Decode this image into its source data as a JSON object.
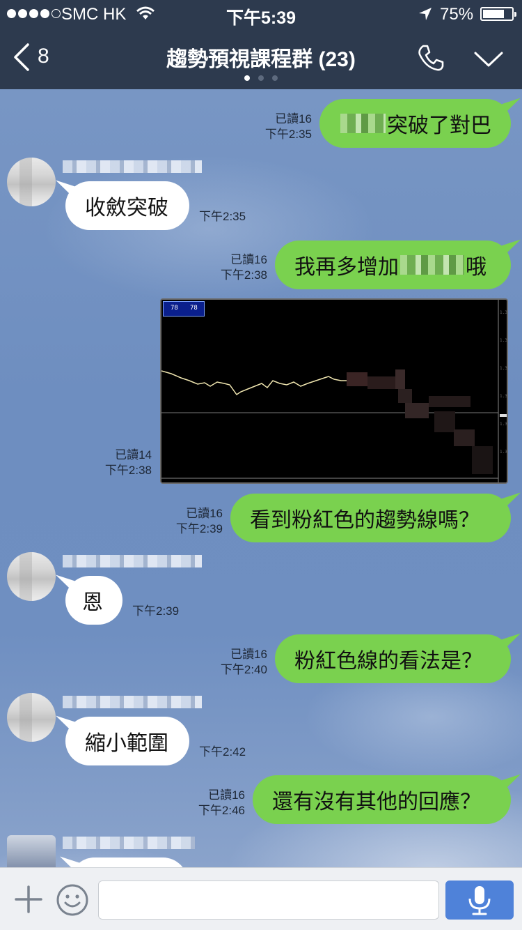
{
  "status_bar": {
    "carrier": "SMC HK",
    "time": "下午5:39",
    "battery": "75%",
    "battery_level": 0.75
  },
  "nav": {
    "back_count": "8",
    "title": "趨勢預視課程群 (23)",
    "page_count": 3,
    "active_page": 1
  },
  "messages": [
    {
      "id": "m1",
      "side": "out",
      "read": "已讀16",
      "time": "下午2:35",
      "text_before": "",
      "text_after": "突破了對巴"
    },
    {
      "id": "m2",
      "side": "in",
      "time": "下午2:35",
      "text": "收斂突破"
    },
    {
      "id": "m3",
      "side": "out",
      "read": "已讀16",
      "time": "下午2:38",
      "text_before": "我再多增加",
      "text_after": "哦"
    },
    {
      "id": "m4",
      "side": "out",
      "kind": "image",
      "read": "已讀14",
      "time": "下午2:38"
    },
    {
      "id": "m5",
      "side": "out",
      "read": "已讀16",
      "time": "下午2:39",
      "text": "看到粉紅色的趨勢線嗎？"
    },
    {
      "id": "m6",
      "side": "in",
      "time": "下午2:39",
      "text": "恩"
    },
    {
      "id": "m7",
      "side": "out",
      "read": "已讀16",
      "time": "下午2:40",
      "text": "粉紅色線的看法是？"
    },
    {
      "id": "m8",
      "side": "in",
      "time": "下午2:42",
      "text": "縮小範圍"
    },
    {
      "id": "m9",
      "side": "out",
      "read": "已讀16",
      "time": "下午2:46",
      "text": "還有沒有其他的回應？"
    }
  ],
  "chart_image": {
    "toolbar_left": "78",
    "toolbar_right": "78"
  },
  "input": {
    "placeholder": ""
  },
  "colors": {
    "header": "#2d3a4e",
    "outgoing_bubble": "#7ad14f",
    "incoming_bubble": "#ffffff",
    "voice_button": "#4f82d9"
  }
}
